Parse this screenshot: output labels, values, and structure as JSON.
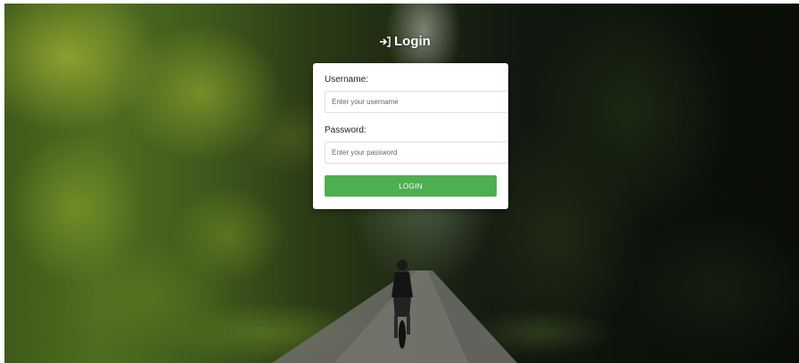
{
  "header": {
    "title": "Login",
    "title_icon": "sign-in-icon"
  },
  "form": {
    "username_label": "Username:",
    "username_placeholder": "Enter your username",
    "username_value": "",
    "password_label": "Password:",
    "password_placeholder": "Enter your password",
    "password_value": "",
    "submit_label": "LOGIN"
  },
  "colors": {
    "button_bg": "#4caf50",
    "card_bg": "#ffffff",
    "title_text": "#ffffff"
  },
  "background": {
    "scene": "forest-path-with-cyclist"
  }
}
